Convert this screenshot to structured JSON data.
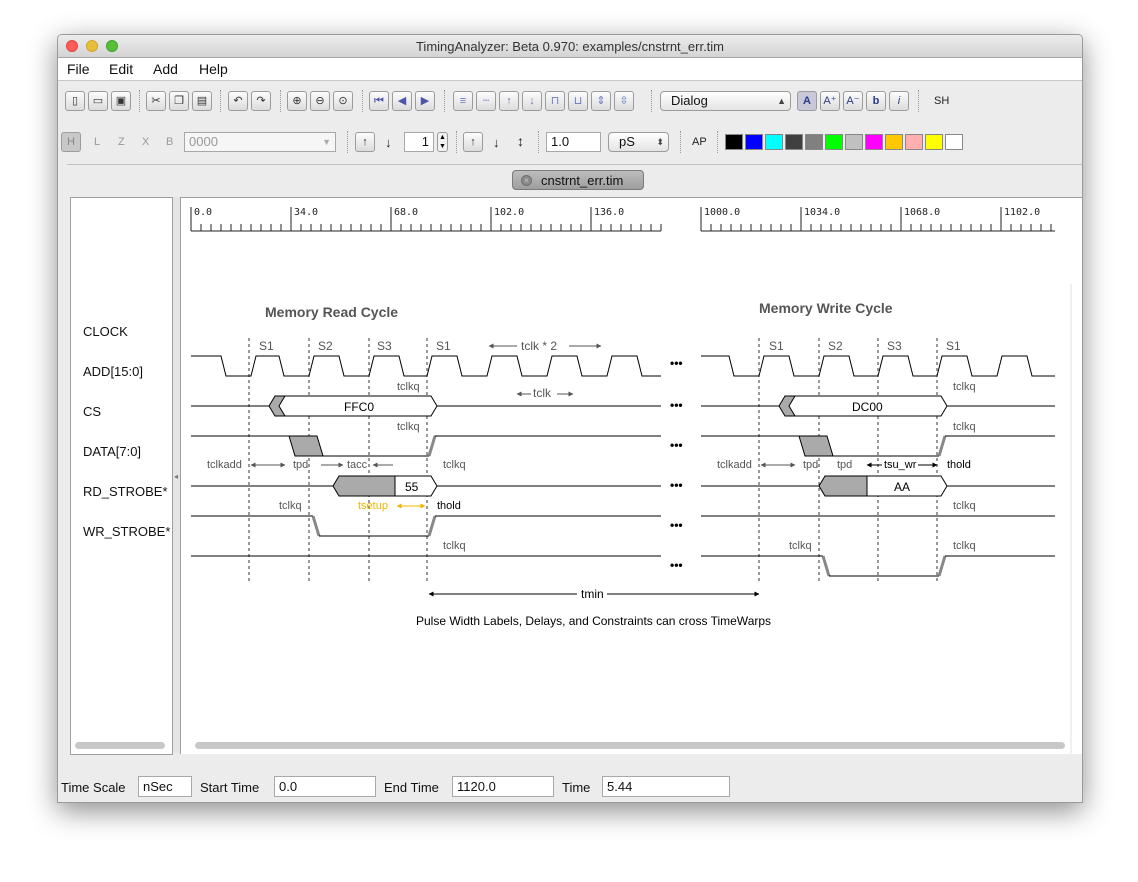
{
  "window": {
    "title": "TimingAnalyzer: Beta 0.970:   examples/cnstrnt_err.tim"
  },
  "menu": [
    "File",
    "Edit",
    "Add",
    "Help"
  ],
  "toolbar1": {
    "font_select": "Dialog",
    "font_buttons": [
      "A",
      "A⁺",
      "A⁻",
      "b",
      "i"
    ],
    "sh_label": "SH"
  },
  "toolbar2": {
    "state_labels": [
      "H",
      "L",
      "Z",
      "X",
      "B"
    ],
    "bus_value": "0000",
    "count_value": "1",
    "time_value": "1.0",
    "unit_select": "pS",
    "ap_label": "AP",
    "colors": [
      "#000000",
      "#0000ff",
      "#00ffff",
      "#404040",
      "#808080",
      "#00ff00",
      "#c0c0c0",
      "#ff00ff",
      "#ffc800",
      "#ffafaf",
      "#ffff00",
      "#ffffff"
    ]
  },
  "doc_tab": {
    "label": "cnstrnt_err.tim"
  },
  "signals": [
    "CLOCK",
    "ADD[15:0]",
    "CS",
    "DATA[7:0]",
    "RD_STROBE*",
    "WR_STROBE*"
  ],
  "ruler": {
    "left_ticks": [
      "0.0",
      "34.0",
      "68.0",
      "102.0",
      "136.0"
    ],
    "right_ticks": [
      "1000.0",
      "1034.0",
      "1068.0",
      "1102.0"
    ]
  },
  "diagram": {
    "read_title": "Memory Read Cycle",
    "write_title": "Memory Write Cycle",
    "states_read": [
      "S1",
      "S2",
      "S3",
      "S1"
    ],
    "states_write": [
      "S1",
      "S2",
      "S3",
      "S1"
    ],
    "tclk2": "tclk * 2",
    "tclk": "tclk",
    "tclkq": "tclkq",
    "tclkadd": "tclkadd",
    "tpd": "tpd",
    "tacc": "tacc",
    "tsetup": "tsetup",
    "thold": "thold",
    "tsu_wr": "tsu_wr",
    "tmin": "tmin",
    "add_read": "FFC0",
    "add_write": "DC00",
    "data_read": "55",
    "data_write": "AA",
    "ellipsis": "•••",
    "caption": "Pulse Width Labels, Delays, and Constraints can cross TimeWarps"
  },
  "status": {
    "time_scale_label": "Time Scale",
    "time_scale_value": "nSec",
    "start_label": "Start Time",
    "start_value": "0.0",
    "end_label": "End Time",
    "end_value": "1120.0",
    "time_label": "Time",
    "time_value": "5.44"
  }
}
